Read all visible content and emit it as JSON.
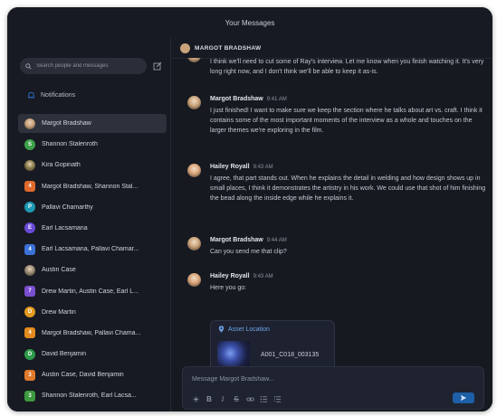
{
  "window": {
    "title": "Your Messages"
  },
  "sidebar": {
    "search_placeholder": "Search people and messages",
    "notifications_label": "Notifications",
    "conversations": [
      {
        "name": "Margot Bradshaw",
        "avatar": "photo",
        "color": "#c9a27a",
        "active": true
      },
      {
        "name": "Shannon Stalenroth",
        "avatar": "S",
        "color": "#3e9f4a"
      },
      {
        "name": "Kira Gopinath",
        "avatar": "photo",
        "color": "#8b7d4b"
      },
      {
        "name": "Margot Bradshaw, Shannon Stal...",
        "avatar": "4",
        "color": "#e06a2c",
        "square": true
      },
      {
        "name": "Pallavi Chamarthy",
        "avatar": "P",
        "color": "#1c9ab3"
      },
      {
        "name": "Earl Lacsamana",
        "avatar": "E",
        "color": "#6a4bd8"
      },
      {
        "name": "Earl Lacsamana, Pallavi Chamar...",
        "avatar": "4",
        "color": "#3a72d8",
        "square": true
      },
      {
        "name": "Austin Case",
        "avatar": "photo",
        "color": "#9a8a74"
      },
      {
        "name": "Drew Martin, Austin Case, Earl L...",
        "avatar": "7",
        "color": "#7a4fd0",
        "square": true
      },
      {
        "name": "Drew Martin",
        "avatar": "D",
        "color": "#e39a1f"
      },
      {
        "name": "Margot Bradshaw, Pallavi Chama...",
        "avatar": "4",
        "color": "#e38a1f",
        "square": true
      },
      {
        "name": "David Benjamin",
        "avatar": "D",
        "color": "#2e9a4a"
      },
      {
        "name": "Austin Case, David Benjamin",
        "avatar": "3",
        "color": "#e07a2c",
        "square": true
      },
      {
        "name": "Shannon Stalenroth, Earl Lacsa...",
        "avatar": "3",
        "color": "#3c9a3e",
        "square": true
      }
    ]
  },
  "chat": {
    "header_name": "MARGOT BRADSHAW",
    "messages": [
      {
        "sender": "",
        "time": "",
        "avatar_color": "#c9a27a",
        "text": "I think we'll need to cut some of Ray's interview. Let me know when you finish watching it. It's very long right now, and I don't think we'll be able to keep it as-is."
      },
      {
        "sender": "Margot Bradshaw",
        "time": "9:41 AM",
        "avatar_color": "#c9a27a",
        "text": "I just finished! I want to make sure we keep the section where he talks about art vs. craft. I think it contains some of the most important moments of the interview as a whole and touches on the larger themes we're exploring in the film."
      },
      {
        "sender": "Hailey Royall",
        "time": "9:43 AM",
        "avatar_color": "#d9a47a",
        "text": "I agree, that part stands out. When he explains the detail in welding and how design shows up in small places, I think it demonstrates the artistry in his work. We could use that shot of him finishing the bead along the inside edge while he explains it."
      },
      {
        "sender": "Margot Bradshaw",
        "time": "9:44 AM",
        "avatar_color": "#c9a27a",
        "text": "Can you send me that clip?"
      },
      {
        "sender": "Hailey Royall",
        "time": "9:43 AM",
        "avatar_color": "#d9a47a",
        "text": "Here you go:",
        "attachment": {
          "title": "Asset Location",
          "file": "A001_C018_003135"
        }
      }
    ],
    "composer_placeholder": "Message Margot Bradshaw...",
    "toolbar": [
      "plus-icon",
      "bold-icon",
      "italic-icon",
      "strikethrough-icon",
      "link-icon",
      "bulleted-list-icon",
      "numbered-list-icon"
    ],
    "accent": "#1d5fa8"
  }
}
